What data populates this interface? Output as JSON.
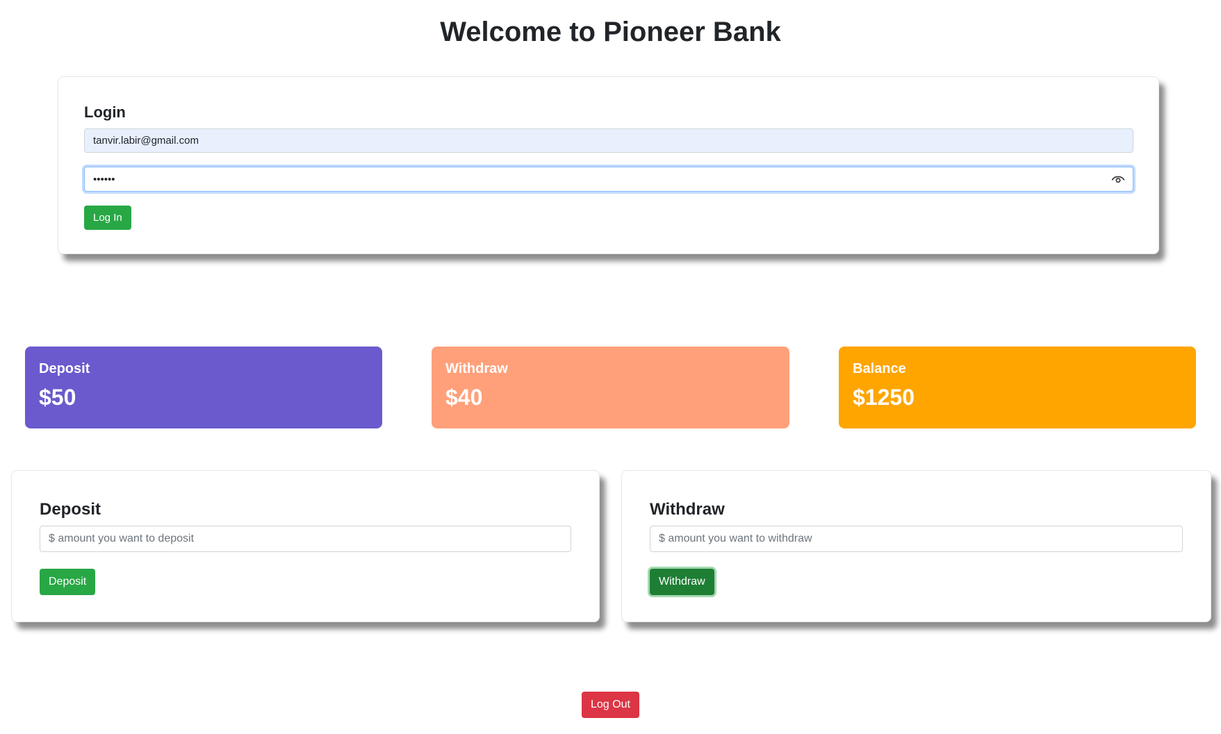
{
  "page": {
    "title": "Welcome to Pioneer Bank"
  },
  "login": {
    "title": "Login",
    "email_value": "tanvir.labir@gmail.com",
    "password_value": "123456",
    "password_icon": "eye-icon",
    "button_label": "Log In"
  },
  "stats": {
    "deposit": {
      "label": "Deposit",
      "value": "$50",
      "color": "#6a5acd"
    },
    "withdraw": {
      "label": "Withdraw",
      "value": "$40",
      "color": "#ffa07a"
    },
    "balance": {
      "label": "Balance",
      "value": "$1250",
      "color": "#ffa500"
    }
  },
  "deposit_form": {
    "title": "Deposit",
    "placeholder": "$ amount you want to deposit",
    "button_label": "Deposit"
  },
  "withdraw_form": {
    "title": "Withdraw",
    "placeholder": "$ amount you want to withdraw",
    "button_label": "Withdraw"
  },
  "logout": {
    "button_label": "Log Out"
  },
  "colors": {
    "success": "#28a745",
    "success_active": "#1e7e34",
    "danger": "#dc3545"
  }
}
